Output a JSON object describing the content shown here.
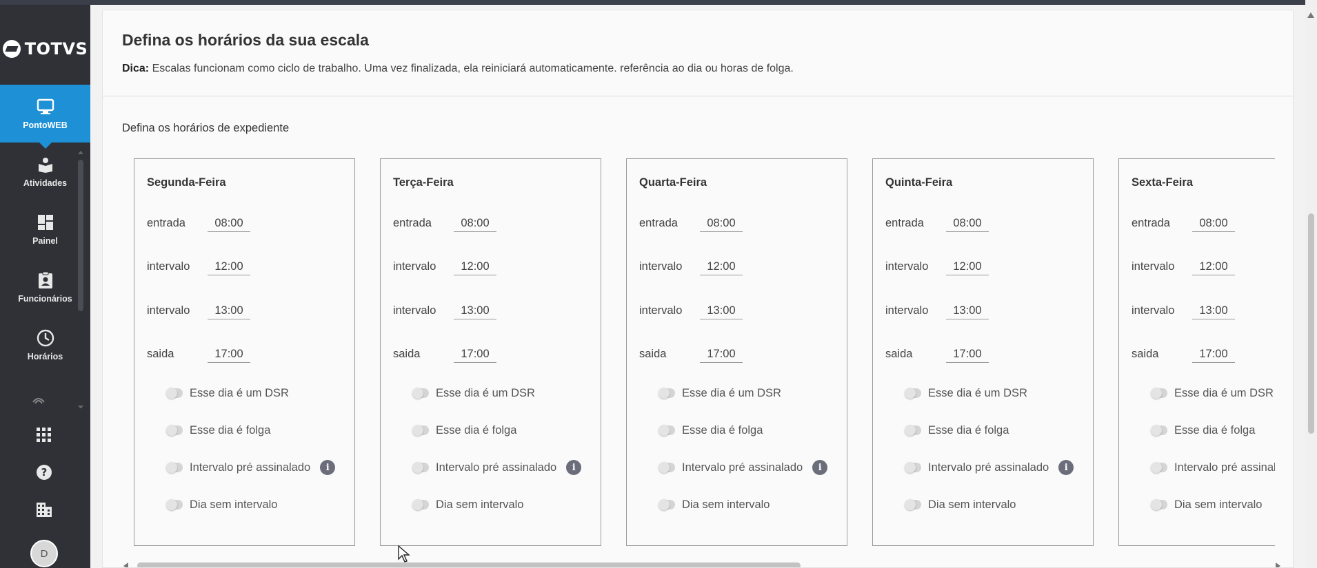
{
  "brand": {
    "name": "TOTVS"
  },
  "sidebar": {
    "items": [
      {
        "label": "PontoWEB",
        "icon": "monitor-icon",
        "active": true
      },
      {
        "label": "Atividades",
        "icon": "book-user-icon"
      },
      {
        "label": "Painel",
        "icon": "dashboard-icon"
      },
      {
        "label": "Funcionários",
        "icon": "clipboard-user-icon"
      },
      {
        "label": "Horários",
        "icon": "clock-icon"
      }
    ],
    "bottom": [
      "apps-grid-icon",
      "help-icon",
      "building-icon"
    ],
    "avatar_initial": "D"
  },
  "page": {
    "title": "Defina os horários da sua escala",
    "tip_label": "Dica:",
    "tip_text": " Escalas funcionam como ciclo de trabalho. Uma vez finalizada, ela reiniciará automaticamente. referência ao dia ou horas de folga.",
    "subtitle": "Defina os horários de expediente"
  },
  "days": [
    {
      "name": "Segunda-Feira",
      "entrada": "08:00",
      "intervalo1": "12:00",
      "intervalo2": "13:00",
      "saida": "17:00"
    },
    {
      "name": "Terça-Feira",
      "entrada": "08:00",
      "intervalo1": "12:00",
      "intervalo2": "13:00",
      "saida": "17:00"
    },
    {
      "name": "Quarta-Feira",
      "entrada": "08:00",
      "intervalo1": "12:00",
      "intervalo2": "13:00",
      "saida": "17:00"
    },
    {
      "name": "Quinta-Feira",
      "entrada": "08:00",
      "intervalo1": "12:00",
      "intervalo2": "13:00",
      "saida": "17:00"
    },
    {
      "name": "Sexta-Feira",
      "entrada": "08:00",
      "intervalo1": "12:00",
      "intervalo2": "13:00",
      "saida": "17:00"
    }
  ],
  "labels": {
    "entrada": "entrada",
    "intervalo": "intervalo",
    "saida": "saida",
    "dsr": "Esse dia é um DSR",
    "folga": "Esse dia é folga",
    "pre_assinalado": "Intervalo pré assinalado",
    "sem_intervalo": "Dia sem intervalo"
  },
  "colors": {
    "accent": "#1e90d6",
    "sidebar": "#2f3137"
  }
}
